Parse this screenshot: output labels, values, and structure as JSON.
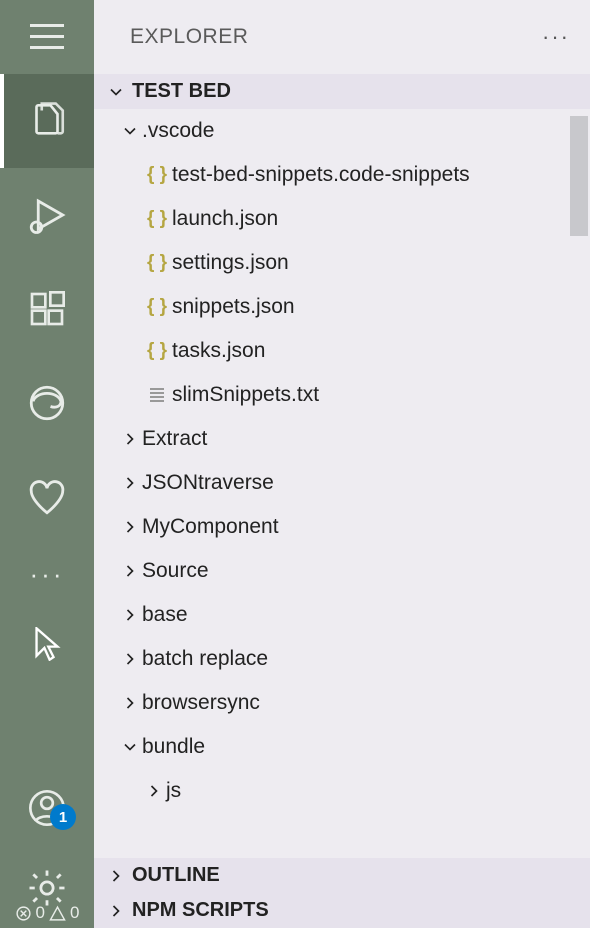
{
  "header": {
    "title": "EXPLORER"
  },
  "sections": {
    "testbed": {
      "label": "TEST BED",
      "expanded": true
    },
    "outline": {
      "label": "OUTLINE",
      "expanded": false
    },
    "npm": {
      "label": "NPM SCRIPTS",
      "expanded": false
    }
  },
  "tree": {
    "vscode": {
      "label": ".vscode",
      "expanded": true
    },
    "vscode_files": {
      "snippets_code": "test-bed-snippets.code-snippets",
      "launch": "launch.json",
      "settings": "settings.json",
      "snippets": "snippets.json",
      "tasks": "tasks.json",
      "slim": "slimSnippets.txt"
    },
    "folders": {
      "extract": "Extract",
      "jsontraverse": "JSONtraverse",
      "mycomponent": "MyComponent",
      "source": "Source",
      "base": "base",
      "batchreplace": "batch replace",
      "browsersync": "browsersync",
      "bundle": "bundle",
      "js": "js"
    }
  },
  "activity": {
    "badge_count": "1"
  },
  "status": {
    "errors": "0",
    "warnings": "0"
  },
  "icons": {
    "json_braces": "{ }"
  }
}
